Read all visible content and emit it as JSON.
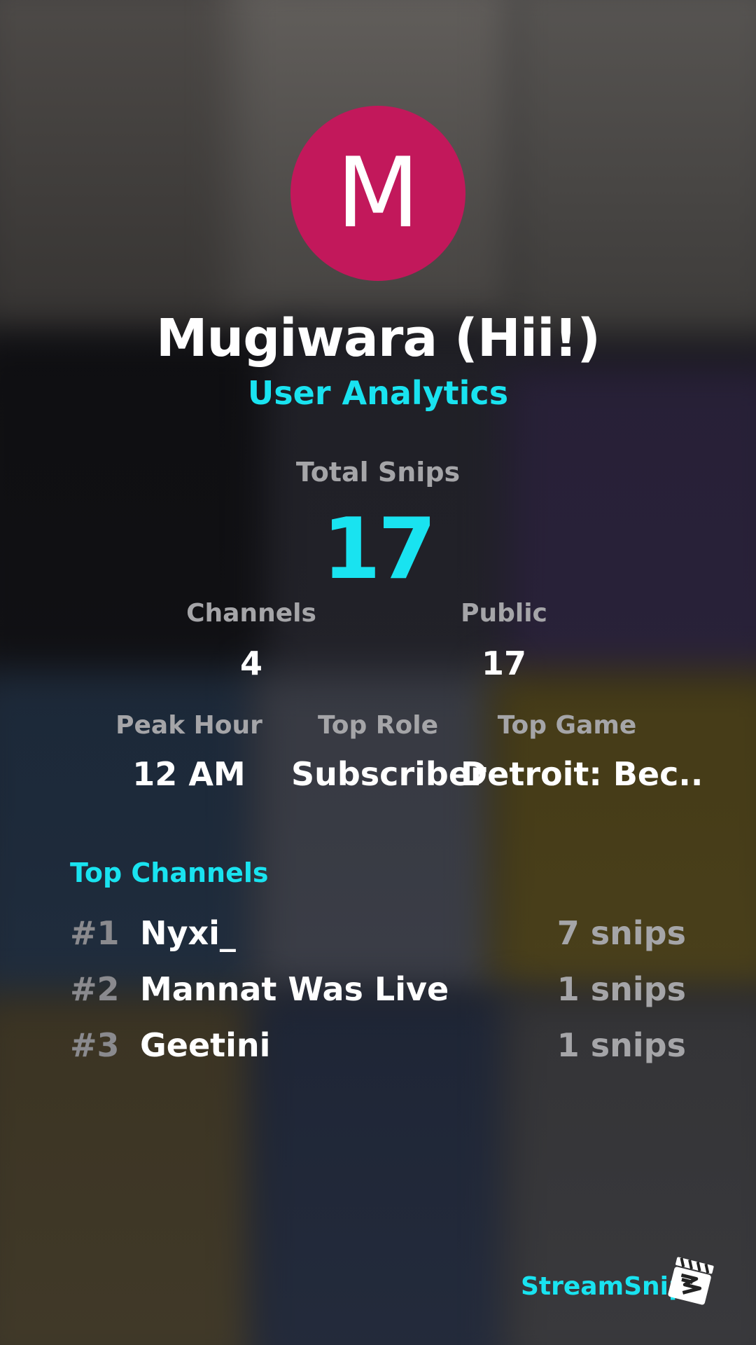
{
  "profile": {
    "avatar_letter": "M",
    "avatar_color": "#c2185b",
    "username": "Mugiwara (Hii!)",
    "subtitle": "User Analytics"
  },
  "totals": {
    "total_label": "Total Snips",
    "total_value": "17"
  },
  "stats_row1": [
    {
      "label": "Channels",
      "value": "4"
    },
    {
      "label": "Public",
      "value": "17"
    }
  ],
  "stats_row2": [
    {
      "label": "Peak Hour",
      "value": "12 AM"
    },
    {
      "label": "Top Role",
      "value": "Subscriber"
    },
    {
      "label": "Top Game",
      "value": "Detroit: Bec.."
    }
  ],
  "top_channels": {
    "title": "Top Channels",
    "items": [
      {
        "rank": "#1",
        "name": "Nyxi_",
        "count": "7 snips"
      },
      {
        "rank": "#2",
        "name": "Mannat Was Live",
        "count": "1 snips"
      },
      {
        "rank": "#3",
        "name": "Geetini",
        "count": "1 snips"
      }
    ]
  },
  "brand": {
    "name": "StreamSnip",
    "logo_icon": "clapperboard-icon"
  },
  "colors": {
    "accent": "#19e3f0",
    "muted": "#a5a5a8",
    "rank": "#8a8a8e"
  }
}
